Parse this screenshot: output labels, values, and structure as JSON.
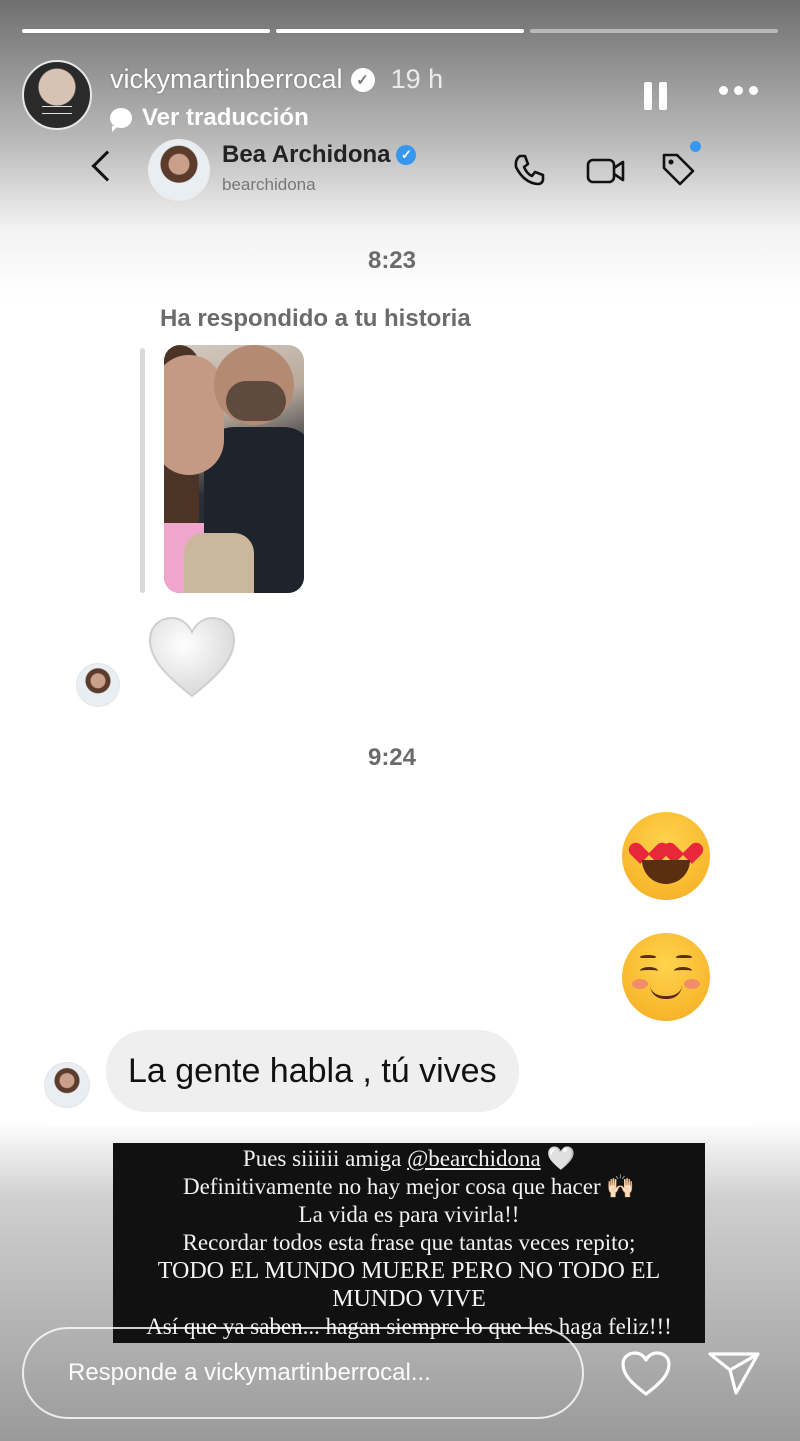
{
  "story": {
    "progress": [
      1.0,
      1.0,
      0.0
    ],
    "username": "vickymartinberrocal",
    "time": "19 h",
    "translate_label": "Ver traducción"
  },
  "dm": {
    "contact_name": "Bea Archidona",
    "contact_handle": "bearchidona",
    "time_1": "8:23",
    "reply_note": "Ha respondido a tu historia",
    "time_2": "9:24",
    "message": "La gente habla , tú vives"
  },
  "caption": {
    "line1_prefix": "Pues siiiiii amiga ",
    "line1_mention": "@bearchidona",
    "line1_suffix": " 🤍",
    "line2": "Definitivamente no hay mejor cosa que hacer 🙌🏻",
    "line3": "La vida es para vivirla!!",
    "line4": "Recordar todos esta frase que tantas veces repito;",
    "line5": "TODO EL MUNDO MUERE PERO NO TODO EL MUNDO VIVE",
    "line6": "Así que ya saben... hagan siempre lo que les haga feliz!!!"
  },
  "reply": {
    "placeholder": "Responde a vickymartinberrocal..."
  },
  "icons": {
    "verified": "verified-badge-icon",
    "pause": "pause-icon",
    "more": "more-options-icon",
    "back": "back-arrow-icon",
    "phone": "phone-icon",
    "video": "video-camera-icon",
    "tag": "tag-icon",
    "heart": "heart-icon",
    "send": "send-icon"
  },
  "colors": {
    "accent_blue": "#3797f0",
    "bubble_gray": "#efefef",
    "caption_bg": "#111111"
  }
}
